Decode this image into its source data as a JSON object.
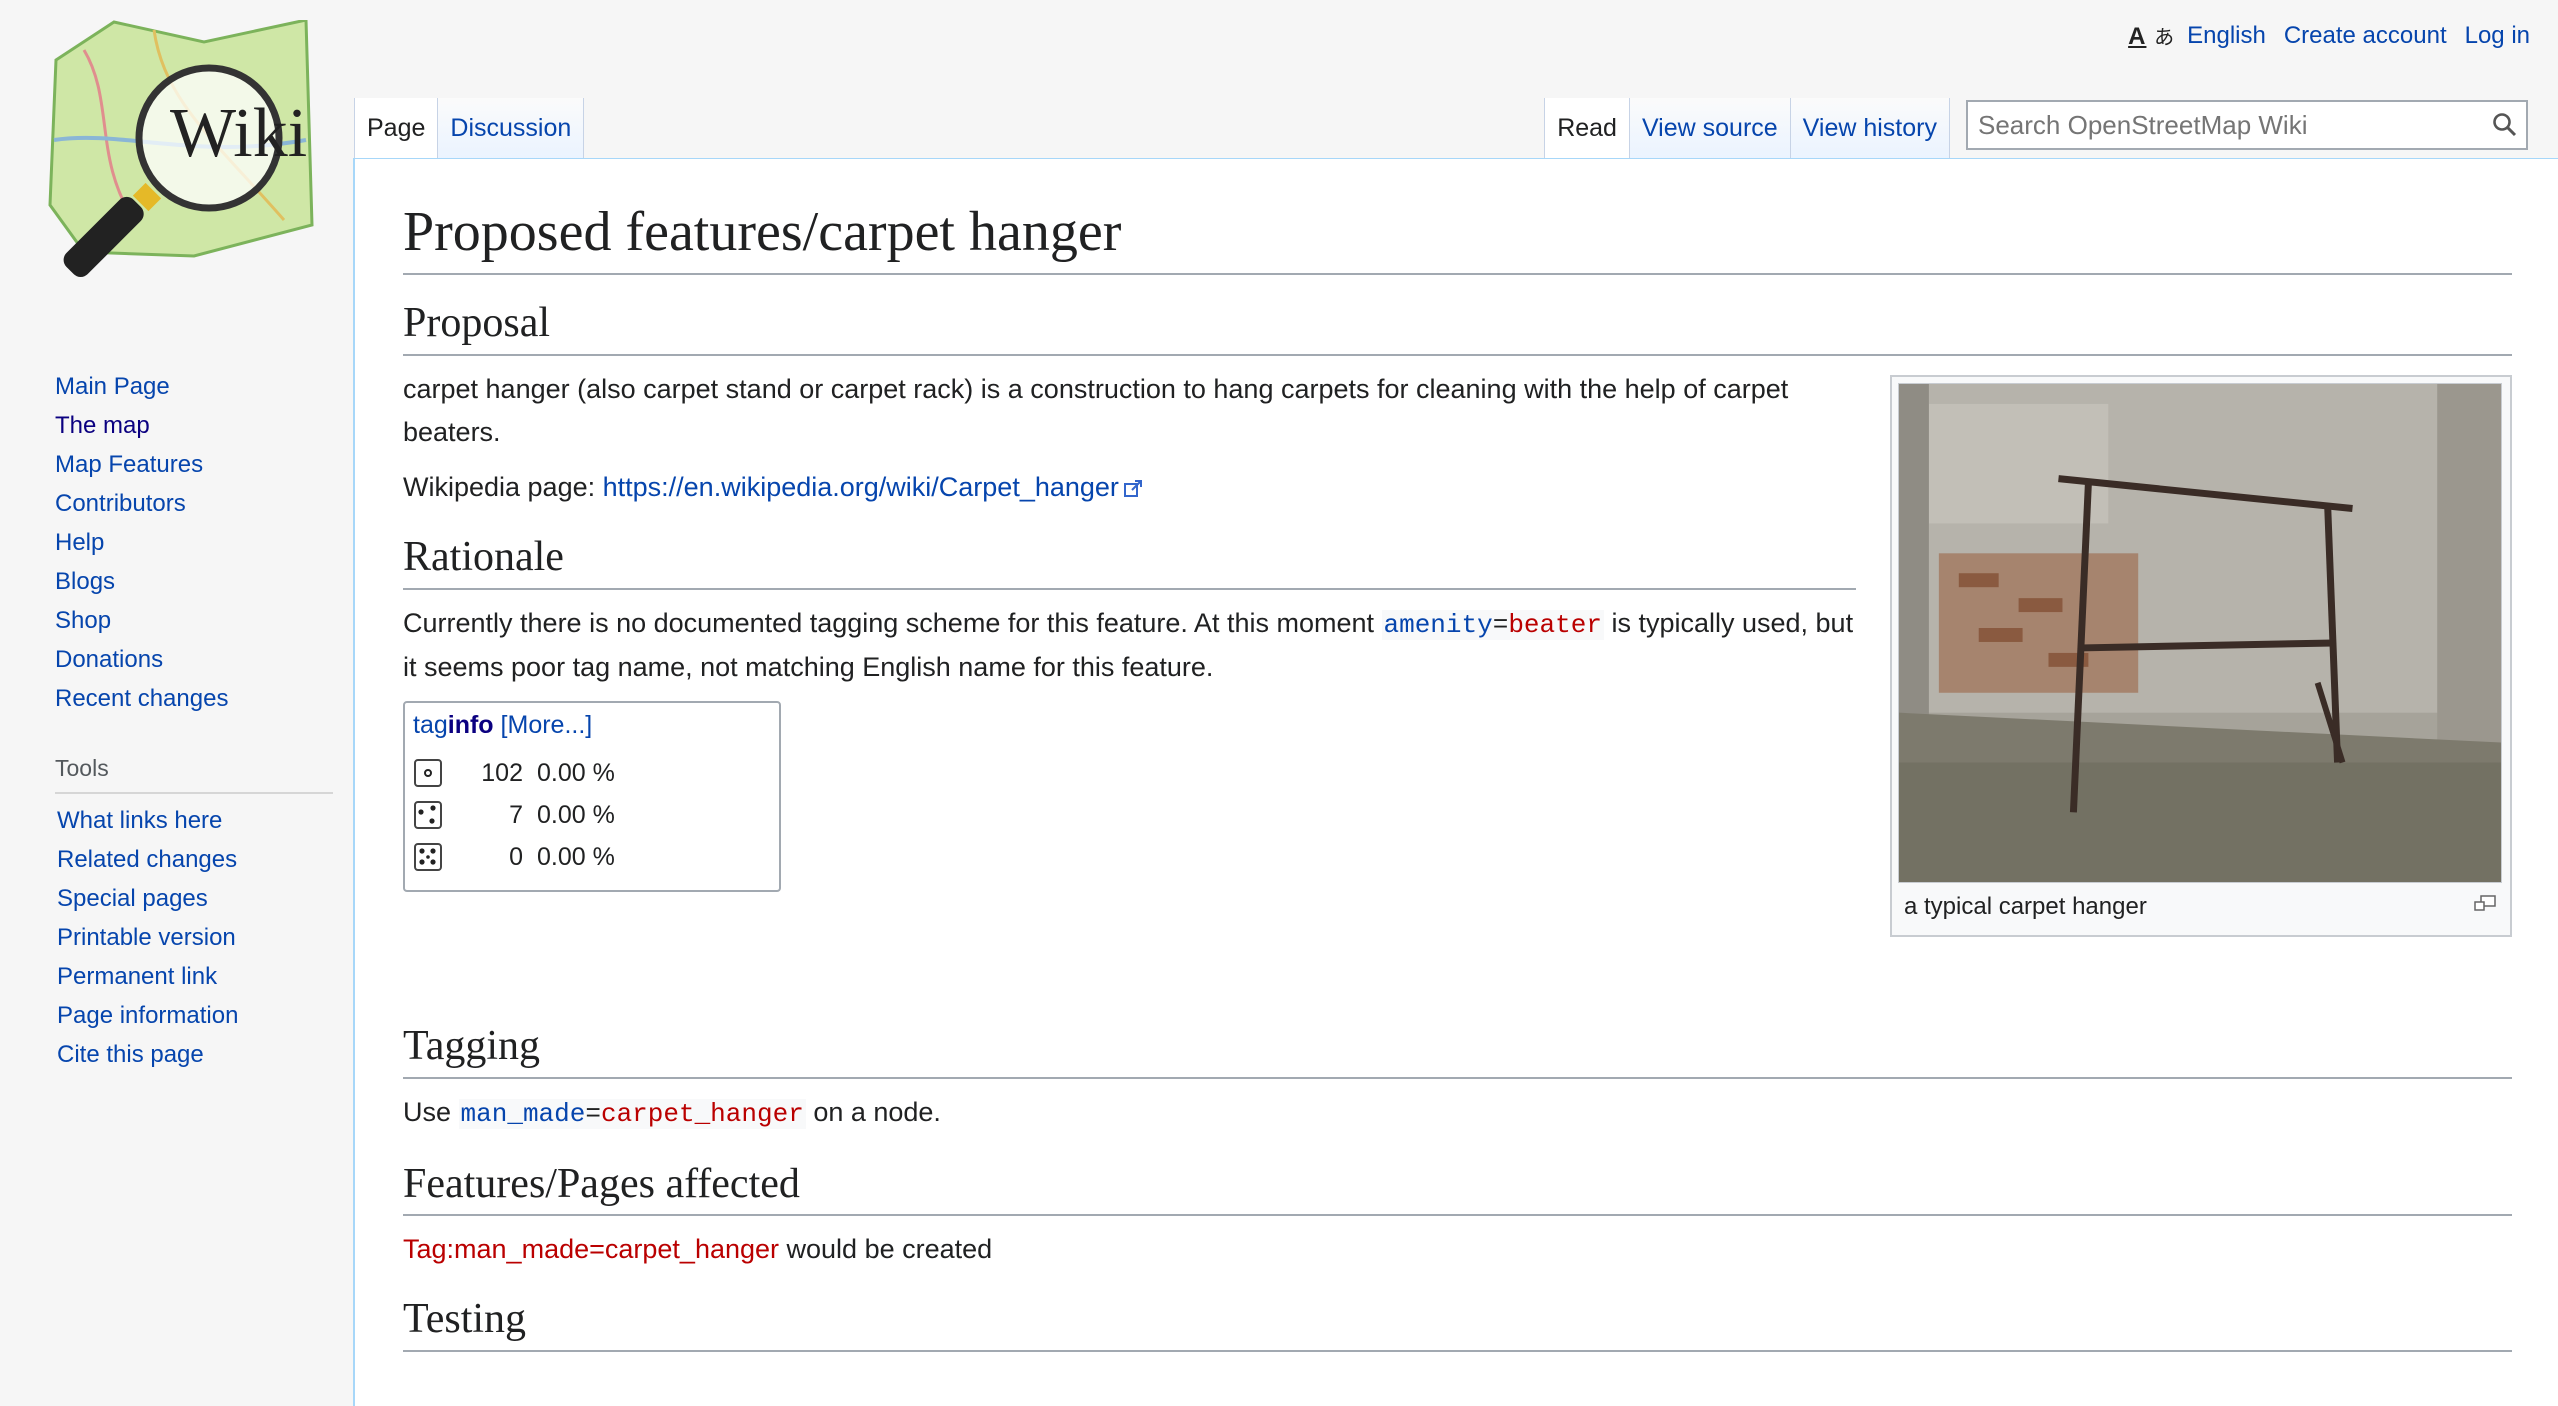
{
  "logo": {
    "text": "Wiki"
  },
  "personal": {
    "language": "English",
    "create_account": "Create account",
    "log_in": "Log in",
    "uls_glyphs": "A あ"
  },
  "sidebar": {
    "nav": [
      {
        "label": "Main Page"
      },
      {
        "label": "The map"
      },
      {
        "label": "Map Features"
      },
      {
        "label": "Contributors"
      },
      {
        "label": "Help"
      },
      {
        "label": "Blogs"
      },
      {
        "label": "Shop"
      },
      {
        "label": "Donations"
      },
      {
        "label": "Recent changes"
      }
    ],
    "tools_heading": "Tools",
    "tools": [
      {
        "label": "What links here"
      },
      {
        "label": "Related changes"
      },
      {
        "label": "Special pages"
      },
      {
        "label": "Printable version"
      },
      {
        "label": "Permanent link"
      },
      {
        "label": "Page information"
      },
      {
        "label": "Cite this page"
      }
    ]
  },
  "tabs": {
    "page": "Page",
    "discussion": "Discussion",
    "read": "Read",
    "view_source": "View source",
    "view_history": "View history"
  },
  "search": {
    "placeholder": "Search OpenStreetMap Wiki"
  },
  "content": {
    "title": "Proposed features/carpet hanger",
    "proposal_heading": "Proposal",
    "proposal_text": "carpet hanger (also carpet stand or carpet rack) is a construction to hang carpets for cleaning with the help of carpet beaters.",
    "wikipedia_label": "Wikipedia page: ",
    "wikipedia_link": "https://en.wikipedia.org/wiki/Carpet_hanger",
    "rationale_heading": "Rationale",
    "rationale_pre": "Currently there is no documented tagging scheme for this feature. At this moment ",
    "rationale_key": "amenity",
    "rationale_eq": "=",
    "rationale_val": "beater",
    "rationale_post": " is typically used, but it seems poor tag name, not matching English name for this feature.",
    "taginfo": {
      "brand_prefix": "tag",
      "brand_bold": "info",
      "more": "[More...]",
      "rows": [
        {
          "type": "node-icon",
          "count": "102",
          "pct": "0.00 %"
        },
        {
          "type": "way-icon",
          "count": "7",
          "pct": "0.00 %"
        },
        {
          "type": "relation-icon",
          "count": "0",
          "pct": "0.00 %"
        }
      ]
    },
    "tagging_heading": "Tagging",
    "tagging_use": "Use ",
    "tagging_key": "man_made",
    "tagging_eq": "=",
    "tagging_val": "carpet_hanger",
    "tagging_post": " on a node.",
    "affected_heading": "Features/Pages affected",
    "affected_link": "Tag:man_made=carpet_hanger",
    "affected_post": " would be created",
    "testing_heading": "Testing",
    "thumb_caption": "a typical carpet hanger"
  }
}
